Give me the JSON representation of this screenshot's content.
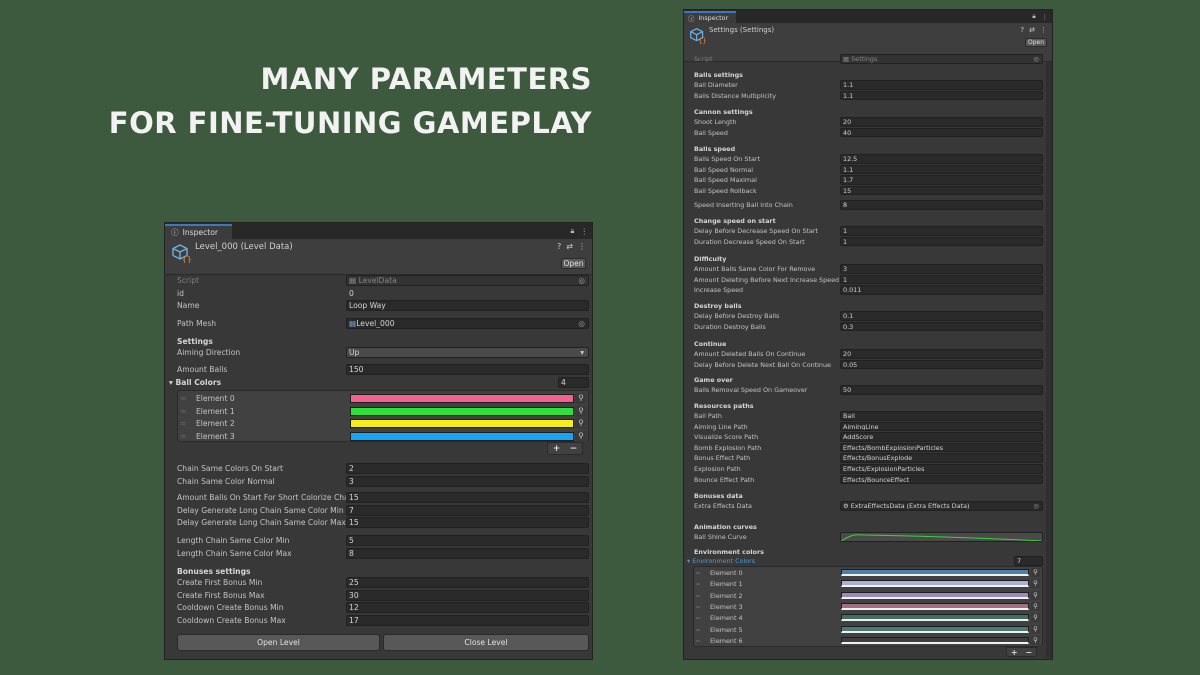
{
  "headline": {
    "line1": "MANY PARAMETERS",
    "line2": "FOR FINE-TUNING GAMEPLAY"
  },
  "left": {
    "tab": "Inspector",
    "title": "Level_000 (Level Data)",
    "open": "Open",
    "script_label": "Script",
    "script_value": "LevelData",
    "id_label": "id",
    "id_value": "0",
    "name_label": "Name",
    "name_value": "Loop Way",
    "mesh_label": "Path Mesh",
    "mesh_value": "Level_000",
    "settings": "Settings",
    "aiming_label": "Aiming Direction",
    "aiming_value": "Up",
    "amount_label": "Amount Balls",
    "amount_value": "150",
    "colors_label": "Ball Colors",
    "colors_count": "4",
    "elements": [
      "Element 0",
      "Element 1",
      "Element 2",
      "Element 3"
    ],
    "element_colors": [
      "#f2628f",
      "#2ee13a",
      "#f6ee1a",
      "#14a5f3"
    ],
    "plus": "+",
    "minus": "−",
    "params1": [
      {
        "label": "Chain Same Colors On Start",
        "value": "2"
      },
      {
        "label": "Chain Same Color Normal",
        "value": "3"
      }
    ],
    "params2": [
      {
        "label": "Amount Balls On Start For Short Colorize Chain",
        "value": "15"
      },
      {
        "label": "Delay Generate Long Chain Same Color Min",
        "value": "7"
      },
      {
        "label": "Delay Generate Long Chain Same Color Max",
        "value": "15"
      }
    ],
    "params3": [
      {
        "label": "Length Chain Same Color Min",
        "value": "5"
      },
      {
        "label": "Length Chain Same Color Max",
        "value": "8"
      }
    ],
    "bonuses": "Bonuses settings",
    "params4": [
      {
        "label": "Create First Bonus Min",
        "value": "25"
      },
      {
        "label": "Create First Bonus Max",
        "value": "30"
      },
      {
        "label": "Cooldown Create Bonus Min",
        "value": "12"
      },
      {
        "label": "Cooldown Create Bonus Max",
        "value": "17"
      }
    ],
    "btn_open_level": "Open Level",
    "btn_close_level": "Close Level"
  },
  "right": {
    "tab": "Inspector",
    "title": "Settings (Settings)",
    "open": "Open",
    "script_label": "Script",
    "script_value": "Settings",
    "sections": [
      {
        "head": "Balls settings",
        "rows": [
          {
            "label": "Ball Diameter",
            "value": "1.1"
          },
          {
            "label": "Balls Distance Multiplicity",
            "value": "1.1"
          }
        ]
      },
      {
        "head": "Cannon settings",
        "rows": [
          {
            "label": "Shoot Length",
            "value": "20"
          },
          {
            "label": "Ball Speed",
            "value": "40"
          }
        ]
      },
      {
        "head": "Balls speed",
        "rows": [
          {
            "label": "Balls Speed On Start",
            "value": "12.5"
          },
          {
            "label": "Ball Speed Normal",
            "value": "1.1"
          },
          {
            "label": "Ball Speed Maximal",
            "value": "1.7"
          },
          {
            "label": "Ball Speed Rollback",
            "value": "15"
          }
        ]
      },
      {
        "head": "",
        "rows": [
          {
            "label": "Speed Inserting Ball Into Chain",
            "value": "8"
          }
        ]
      },
      {
        "head": "Change speed on start",
        "rows": [
          {
            "label": "Delay Before Decrease Speed On Start",
            "value": "1"
          },
          {
            "label": "Duration Decrease Speed On Start",
            "value": "1"
          }
        ]
      },
      {
        "head": "Difficulty",
        "rows": [
          {
            "label": "Amount Balls Same Color For Remove",
            "value": "3"
          },
          {
            "label": "Amount Deleting Before Next Increase Speed",
            "value": "1"
          },
          {
            "label": "Increase Speed",
            "value": "0.011"
          }
        ]
      },
      {
        "head": "Destroy balls",
        "rows": [
          {
            "label": "Delay Before Destroy Balls",
            "value": "0.1"
          },
          {
            "label": "Duration Destroy Balls",
            "value": "0.3"
          }
        ]
      },
      {
        "head": "Continue",
        "rows": [
          {
            "label": "Amount Deleted Balls On Continue",
            "value": "20"
          },
          {
            "label": "Delay Before Delete Next Ball On Continue",
            "value": "0.05"
          }
        ]
      },
      {
        "head": "Game over",
        "rows": [
          {
            "label": "Balls Removal Speed On Gameover",
            "value": "50"
          }
        ]
      },
      {
        "head": "Resources paths",
        "rows": [
          {
            "label": "Ball Path",
            "value": "Ball"
          },
          {
            "label": "Aiming Line Path",
            "value": "AimingLine"
          },
          {
            "label": "Visualize Score Path",
            "value": "AddScore"
          },
          {
            "label": "Bomb Explosion Path",
            "value": "Effects/BombExplosionParticles"
          },
          {
            "label": "Bonus Effect Path",
            "value": "Effects/BonusExplode"
          },
          {
            "label": "Explosion Path",
            "value": "Effects/ExplosionParticles"
          },
          {
            "label": "Bounce Effect Path",
            "value": "Effects/BounceEffect"
          }
        ]
      },
      {
        "head": "Bonuses data",
        "rows": [
          {
            "label": "Extra Effects Data",
            "value": "ExtraEffectsData (Extra Effects Data)"
          }
        ]
      }
    ],
    "anim_head": "Animation curves",
    "anim_label": "Ball Shine Curve",
    "env_head": "Environment colors",
    "env_label": "Environment Colors",
    "env_count": "7",
    "env_elements": [
      "Element 0",
      "Element 1",
      "Element 2",
      "Element 3",
      "Element 4",
      "Element 5",
      "Element 6"
    ],
    "env_colors": [
      "#4e7fa6",
      "#a9b0d6",
      "#9a8cb8",
      "#a06f82",
      "#3f6e63",
      "#4a7a72",
      "#3d3e3e"
    ],
    "plus": "+",
    "minus": "−"
  }
}
